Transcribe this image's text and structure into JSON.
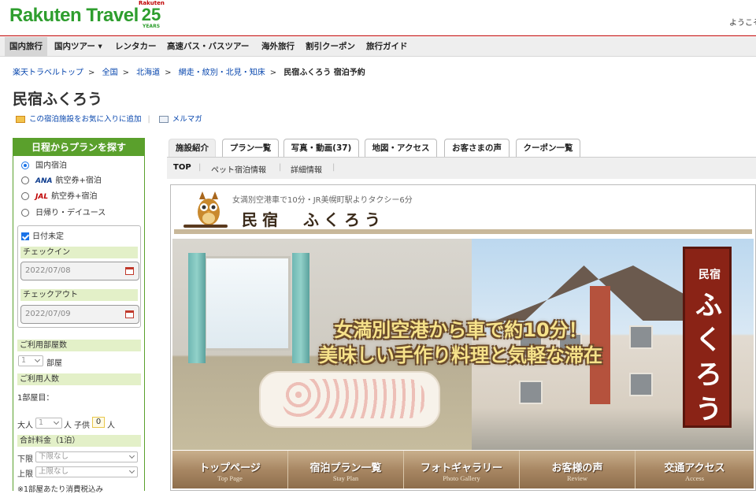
{
  "header": {
    "logo": "Rakuten Travel",
    "badge_top": "Rakuten",
    "badge_num": "25",
    "badge_years": "YEARS",
    "welcome": "ようこそ"
  },
  "gnav": [
    {
      "label": "国内旅行"
    },
    {
      "label": "国内ツアー ▾"
    },
    {
      "label": "レンタカー"
    },
    {
      "label": "高速バス・バスツアー"
    },
    {
      "label": "海外旅行"
    },
    {
      "label": "割引クーポン"
    },
    {
      "label": "旅行ガイド"
    }
  ],
  "breadcrumb": [
    "楽天トラベルトップ",
    "全国",
    "北海道",
    "網走・紋別・北見・知床",
    "民宿ふくろう 宿泊予約"
  ],
  "page_title": "民宿ふくろう",
  "fav": {
    "add_label": "この宿泊施設をお気に入りに追加",
    "mail_label": "メルマガ"
  },
  "side": {
    "title": "日程からプランを探す",
    "options": [
      "国内宿泊",
      "航空券+宿泊",
      "航空券+宿泊",
      "日帰り・デイユース"
    ],
    "airlines": [
      "ANA",
      "JAL"
    ],
    "undecided_label": "日付未定",
    "checkin_label": "チェックイン",
    "checkin_value": "2022/07/08",
    "checkout_label": "チェックアウト",
    "checkout_value": "2022/07/09",
    "rooms_label": "ご利用部屋数",
    "rooms_value": "1",
    "rooms_unit": "部屋",
    "guests_label": "ご利用人数",
    "room1_label": "1部屋目：",
    "adult_label": "大人",
    "adult_value": "1",
    "adult_unit": "人",
    "child_label": "子供",
    "child_value": "0",
    "child_unit": "人",
    "price_label": "合計料金（1泊）",
    "min_label": "下限",
    "min_value": "下限なし",
    "max_label": "上限",
    "max_value": "上限なし",
    "tax_note": "※1部屋あたり消費税込み"
  },
  "tabs": [
    "施設紹介",
    "プラン一覧",
    "写真・動画(37)",
    "地図・アクセス",
    "お客さまの声",
    "クーポン一覧"
  ],
  "subnav": [
    "TOP",
    "ペット宿泊情報",
    "詳細情報"
  ],
  "hero": {
    "tagline": "女満別空港車で10分・JR美幌町駅よりタクシー6分",
    "name": "民宿　ふくろう",
    "overlay_line1": "女満別空港から車で約10分！",
    "overlay_line2": "美味しい手作り料理と気軽な滞在",
    "sign_top": "民宿",
    "sign_main": "ふくろう",
    "nav": [
      {
        "jp": "トップページ",
        "en": "Top Page"
      },
      {
        "jp": "宿泊プラン一覧",
        "en": "Stay Plan"
      },
      {
        "jp": "フォトギャラリー",
        "en": "Photo Gallery"
      },
      {
        "jp": "お客様の声",
        "en": "Review"
      },
      {
        "jp": "交通アクセス",
        "en": "Access"
      }
    ]
  },
  "colors": {
    "brand_green": "#2e9e2e",
    "side_green": "#5aa02c",
    "link": "#0645ad",
    "sign_red": "#8a2316"
  }
}
